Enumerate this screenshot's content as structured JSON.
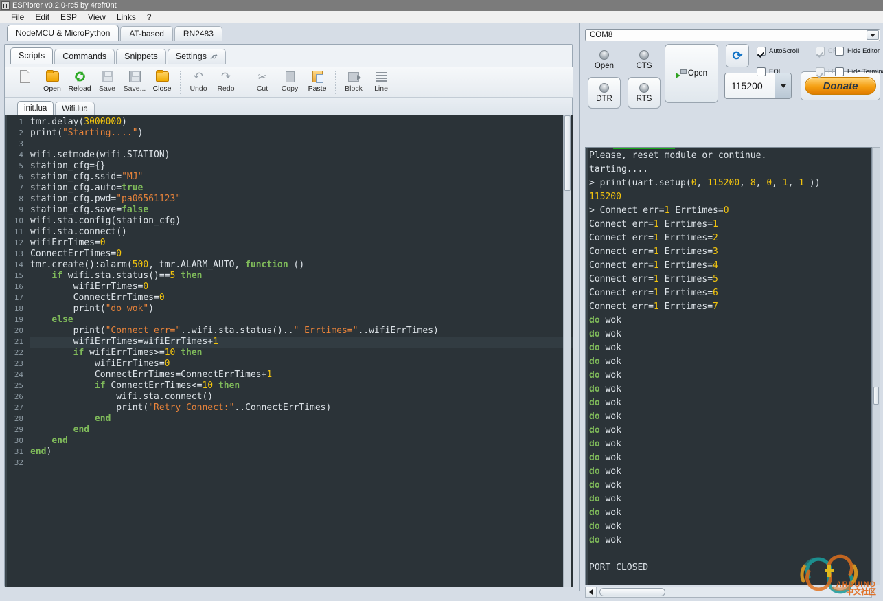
{
  "window": {
    "title": "ESPlorer v0.2.0-rc5 by 4refr0nt",
    "icon": "app-icon"
  },
  "menubar": [
    "File",
    "Edit",
    "ESP",
    "View",
    "Links",
    "?"
  ],
  "top_tabs": [
    {
      "label": "NodeMCU & MicroPython",
      "active": true
    },
    {
      "label": "AT-based",
      "active": false
    },
    {
      "label": "RN2483",
      "active": false
    }
  ],
  "sub_tabs": [
    {
      "label": "Scripts",
      "active": true
    },
    {
      "label": "Commands",
      "active": false
    },
    {
      "label": "Snippets",
      "active": false
    },
    {
      "label": "Settings",
      "active": false,
      "icon": "wrench-icon"
    }
  ],
  "toolbar": [
    {
      "label": "",
      "icon": "new-file-icon",
      "enabled": true
    },
    {
      "label": "Open",
      "icon": "folder-open-icon",
      "enabled": true
    },
    {
      "label": "Reload",
      "icon": "reload-icon",
      "enabled": true
    },
    {
      "label": "Save",
      "icon": "save-icon",
      "enabled": false
    },
    {
      "label": "Save...",
      "icon": "save-as-icon",
      "enabled": false
    },
    {
      "label": "Close",
      "icon": "close-folder-icon",
      "enabled": true
    },
    {
      "label": "Undo",
      "icon": "undo-icon",
      "enabled": false
    },
    {
      "label": "Redo",
      "icon": "redo-icon",
      "enabled": false
    },
    {
      "label": "Cut",
      "icon": "scissors-icon",
      "enabled": false
    },
    {
      "label": "Copy",
      "icon": "copy-icon",
      "enabled": false
    },
    {
      "label": "Paste",
      "icon": "paste-icon",
      "enabled": true
    },
    {
      "label": "Block",
      "icon": "send-block-icon",
      "enabled": false
    },
    {
      "label": "Line",
      "icon": "send-line-icon",
      "enabled": false
    }
  ],
  "file_tabs": [
    {
      "label": "init.lua",
      "active": true
    },
    {
      "label": "Wifi.lua",
      "active": false
    }
  ],
  "editor": {
    "current_line": 21,
    "total_lines": 32,
    "lines": [
      {
        "n": 1,
        "tokens": [
          {
            "t": "nm",
            "v": "tmr.delay("
          },
          {
            "t": "n",
            "v": "3000000"
          },
          {
            "t": "nm",
            "v": ")"
          }
        ]
      },
      {
        "n": 2,
        "tokens": [
          {
            "t": "nm",
            "v": "print("
          },
          {
            "t": "s",
            "v": "\"Starting....\""
          },
          {
            "t": "nm",
            "v": ")"
          }
        ]
      },
      {
        "n": 3,
        "tokens": []
      },
      {
        "n": 4,
        "tokens": [
          {
            "t": "nm",
            "v": "wifi.setmode(wifi.STATION)"
          }
        ]
      },
      {
        "n": 5,
        "tokens": [
          {
            "t": "nm",
            "v": "station_cfg={}"
          }
        ]
      },
      {
        "n": 6,
        "tokens": [
          {
            "t": "nm",
            "v": "station_cfg.ssid="
          },
          {
            "t": "s",
            "v": "\"MJ\""
          }
        ]
      },
      {
        "n": 7,
        "tokens": [
          {
            "t": "nm",
            "v": "station_cfg.auto="
          },
          {
            "t": "k",
            "v": "true"
          }
        ]
      },
      {
        "n": 8,
        "tokens": [
          {
            "t": "nm",
            "v": "station_cfg.pwd="
          },
          {
            "t": "s",
            "v": "\"pa06561123\""
          }
        ]
      },
      {
        "n": 9,
        "tokens": [
          {
            "t": "nm",
            "v": "station_cfg.save="
          },
          {
            "t": "k",
            "v": "false"
          }
        ]
      },
      {
        "n": 10,
        "tokens": [
          {
            "t": "nm",
            "v": "wifi.sta.config(station_cfg)"
          }
        ]
      },
      {
        "n": 11,
        "tokens": [
          {
            "t": "nm",
            "v": "wifi.sta.connect()"
          }
        ]
      },
      {
        "n": 12,
        "tokens": [
          {
            "t": "nm",
            "v": "wifiErrTimes="
          },
          {
            "t": "n",
            "v": "0"
          }
        ]
      },
      {
        "n": 13,
        "tokens": [
          {
            "t": "nm",
            "v": "ConnectErrTimes="
          },
          {
            "t": "n",
            "v": "0"
          }
        ]
      },
      {
        "n": 14,
        "tokens": [
          {
            "t": "nm",
            "v": "tmr.create():alarm("
          },
          {
            "t": "n",
            "v": "500"
          },
          {
            "t": "nm",
            "v": ", tmr.ALARM_AUTO, "
          },
          {
            "t": "k",
            "v": "function"
          },
          {
            "t": "nm",
            "v": " ()"
          }
        ]
      },
      {
        "n": 15,
        "tokens": [
          {
            "t": "nm",
            "v": "    "
          },
          {
            "t": "k",
            "v": "if"
          },
          {
            "t": "nm",
            "v": " wifi.sta.status()=="
          },
          {
            "t": "n",
            "v": "5"
          },
          {
            "t": "nm",
            "v": " "
          },
          {
            "t": "k",
            "v": "then"
          }
        ]
      },
      {
        "n": 16,
        "tokens": [
          {
            "t": "nm",
            "v": "        wifiErrTimes="
          },
          {
            "t": "n",
            "v": "0"
          }
        ]
      },
      {
        "n": 17,
        "tokens": [
          {
            "t": "nm",
            "v": "        ConnectErrTimes="
          },
          {
            "t": "n",
            "v": "0"
          }
        ]
      },
      {
        "n": 18,
        "tokens": [
          {
            "t": "nm",
            "v": "        print("
          },
          {
            "t": "s",
            "v": "\"do wok\""
          },
          {
            "t": "nm",
            "v": ")"
          }
        ]
      },
      {
        "n": 19,
        "tokens": [
          {
            "t": "nm",
            "v": "    "
          },
          {
            "t": "k",
            "v": "else"
          }
        ]
      },
      {
        "n": 20,
        "tokens": [
          {
            "t": "nm",
            "v": "        print("
          },
          {
            "t": "s",
            "v": "\"Connect err=\""
          },
          {
            "t": "nm",
            "v": "..wifi.sta.status().."
          },
          {
            "t": "s",
            "v": "\" Errtimes=\""
          },
          {
            "t": "nm",
            "v": "..wifiErrTimes)"
          }
        ]
      },
      {
        "n": 21,
        "tokens": [
          {
            "t": "nm",
            "v": "        wifiErrTimes=wifiErrTimes+"
          },
          {
            "t": "n",
            "v": "1"
          }
        ]
      },
      {
        "n": 22,
        "tokens": [
          {
            "t": "nm",
            "v": "        "
          },
          {
            "t": "k",
            "v": "if"
          },
          {
            "t": "nm",
            "v": " wifiErrTimes>="
          },
          {
            "t": "n",
            "v": "10"
          },
          {
            "t": "nm",
            "v": " "
          },
          {
            "t": "k",
            "v": "then"
          }
        ]
      },
      {
        "n": 23,
        "tokens": [
          {
            "t": "nm",
            "v": "            wifiErrTimes="
          },
          {
            "t": "n",
            "v": "0"
          }
        ]
      },
      {
        "n": 24,
        "tokens": [
          {
            "t": "nm",
            "v": "            ConnectErrTimes=ConnectErrTimes+"
          },
          {
            "t": "n",
            "v": "1"
          }
        ]
      },
      {
        "n": 25,
        "tokens": [
          {
            "t": "nm",
            "v": "            "
          },
          {
            "t": "k",
            "v": "if"
          },
          {
            "t": "nm",
            "v": " ConnectErrTimes<="
          },
          {
            "t": "n",
            "v": "10"
          },
          {
            "t": "nm",
            "v": " "
          },
          {
            "t": "k",
            "v": "then"
          }
        ]
      },
      {
        "n": 26,
        "tokens": [
          {
            "t": "nm",
            "v": "                wifi.sta.connect()"
          }
        ]
      },
      {
        "n": 27,
        "tokens": [
          {
            "t": "nm",
            "v": "                print("
          },
          {
            "t": "s",
            "v": "\"Retry Connect:\""
          },
          {
            "t": "nm",
            "v": "..ConnectErrTimes)"
          }
        ]
      },
      {
        "n": 28,
        "tokens": [
          {
            "t": "nm",
            "v": "            "
          },
          {
            "t": "k",
            "v": "end"
          }
        ]
      },
      {
        "n": 29,
        "tokens": [
          {
            "t": "nm",
            "v": "        "
          },
          {
            "t": "k",
            "v": "end"
          }
        ]
      },
      {
        "n": 30,
        "tokens": [
          {
            "t": "nm",
            "v": "    "
          },
          {
            "t": "k",
            "v": "end"
          }
        ]
      },
      {
        "n": 31,
        "tokens": [
          {
            "t": "k",
            "v": "end"
          },
          {
            "t": "nm",
            "v": ")"
          }
        ]
      },
      {
        "n": 32,
        "tokens": []
      }
    ]
  },
  "com": {
    "port": "COM8",
    "baud": "115200",
    "leds": [
      {
        "label": "Open",
        "state": "off"
      },
      {
        "label": "CTS",
        "state": "off"
      },
      {
        "label": "DTR",
        "state": "off"
      },
      {
        "label": "RTS",
        "state": "off"
      }
    ],
    "open_button": "Open",
    "refresh_icon": "refresh-icon",
    "donate_label": "Donate",
    "checkboxes": [
      {
        "label": "AutoScroll",
        "checked": true,
        "enabled": true
      },
      {
        "label": "EOL",
        "checked": false,
        "enabled": true
      },
      {
        "label": "CR",
        "checked": true,
        "enabled": false
      },
      {
        "label": "LF",
        "checked": true,
        "enabled": false
      },
      {
        "label": "Hide Editor",
        "checked": false,
        "enabled": true
      },
      {
        "label": "Hide Terminal",
        "checked": false,
        "enabled": true
      }
    ]
  },
  "terminal": {
    "lines": [
      [
        {
          "t": "nm",
          "v": "Please, reset module or continue."
        }
      ],
      [
        {
          "t": "nm",
          "v": "tarting...."
        }
      ],
      [
        {
          "t": "nm",
          "v": "> print(uart.setup("
        },
        {
          "t": "n",
          "v": "0"
        },
        {
          "t": "nm",
          "v": ", "
        },
        {
          "t": "n",
          "v": "115200"
        },
        {
          "t": "nm",
          "v": ", "
        },
        {
          "t": "n",
          "v": "8"
        },
        {
          "t": "nm",
          "v": ", "
        },
        {
          "t": "n",
          "v": "0"
        },
        {
          "t": "nm",
          "v": ", "
        },
        {
          "t": "n",
          "v": "1"
        },
        {
          "t": "nm",
          "v": ", "
        },
        {
          "t": "n",
          "v": "1"
        },
        {
          "t": "nm",
          "v": " ))"
        }
      ],
      [
        {
          "t": "n",
          "v": "115200"
        }
      ],
      [
        {
          "t": "nm",
          "v": "> Connect err="
        },
        {
          "t": "n",
          "v": "1"
        },
        {
          "t": "nm",
          "v": " Errtimes="
        },
        {
          "t": "n",
          "v": "0"
        }
      ],
      [
        {
          "t": "nm",
          "v": "Connect err="
        },
        {
          "t": "n",
          "v": "1"
        },
        {
          "t": "nm",
          "v": " Errtimes="
        },
        {
          "t": "n",
          "v": "1"
        }
      ],
      [
        {
          "t": "nm",
          "v": "Connect err="
        },
        {
          "t": "n",
          "v": "1"
        },
        {
          "t": "nm",
          "v": " Errtimes="
        },
        {
          "t": "n",
          "v": "2"
        }
      ],
      [
        {
          "t": "nm",
          "v": "Connect err="
        },
        {
          "t": "n",
          "v": "1"
        },
        {
          "t": "nm",
          "v": " Errtimes="
        },
        {
          "t": "n",
          "v": "3"
        }
      ],
      [
        {
          "t": "nm",
          "v": "Connect err="
        },
        {
          "t": "n",
          "v": "1"
        },
        {
          "t": "nm",
          "v": " Errtimes="
        },
        {
          "t": "n",
          "v": "4"
        }
      ],
      [
        {
          "t": "nm",
          "v": "Connect err="
        },
        {
          "t": "n",
          "v": "1"
        },
        {
          "t": "nm",
          "v": " Errtimes="
        },
        {
          "t": "n",
          "v": "5"
        }
      ],
      [
        {
          "t": "nm",
          "v": "Connect err="
        },
        {
          "t": "n",
          "v": "1"
        },
        {
          "t": "nm",
          "v": " Errtimes="
        },
        {
          "t": "n",
          "v": "6"
        }
      ],
      [
        {
          "t": "nm",
          "v": "Connect err="
        },
        {
          "t": "n",
          "v": "1"
        },
        {
          "t": "nm",
          "v": " Errtimes="
        },
        {
          "t": "n",
          "v": "7"
        }
      ],
      [
        {
          "t": "k",
          "v": "do"
        },
        {
          "t": "nm",
          "v": " wok"
        }
      ],
      [
        {
          "t": "k",
          "v": "do"
        },
        {
          "t": "nm",
          "v": " wok"
        }
      ],
      [
        {
          "t": "k",
          "v": "do"
        },
        {
          "t": "nm",
          "v": " wok"
        }
      ],
      [
        {
          "t": "k",
          "v": "do"
        },
        {
          "t": "nm",
          "v": " wok"
        }
      ],
      [
        {
          "t": "k",
          "v": "do"
        },
        {
          "t": "nm",
          "v": " wok"
        }
      ],
      [
        {
          "t": "k",
          "v": "do"
        },
        {
          "t": "nm",
          "v": " wok"
        }
      ],
      [
        {
          "t": "k",
          "v": "do"
        },
        {
          "t": "nm",
          "v": " wok"
        }
      ],
      [
        {
          "t": "k",
          "v": "do"
        },
        {
          "t": "nm",
          "v": " wok"
        }
      ],
      [
        {
          "t": "k",
          "v": "do"
        },
        {
          "t": "nm",
          "v": " wok"
        }
      ],
      [
        {
          "t": "k",
          "v": "do"
        },
        {
          "t": "nm",
          "v": " wok"
        }
      ],
      [
        {
          "t": "k",
          "v": "do"
        },
        {
          "t": "nm",
          "v": " wok"
        }
      ],
      [
        {
          "t": "k",
          "v": "do"
        },
        {
          "t": "nm",
          "v": " wok"
        }
      ],
      [
        {
          "t": "k",
          "v": "do"
        },
        {
          "t": "nm",
          "v": " wok"
        }
      ],
      [
        {
          "t": "k",
          "v": "do"
        },
        {
          "t": "nm",
          "v": " wok"
        }
      ],
      [
        {
          "t": "k",
          "v": "do"
        },
        {
          "t": "nm",
          "v": " wok"
        }
      ],
      [
        {
          "t": "k",
          "v": "do"
        },
        {
          "t": "nm",
          "v": " wok"
        }
      ],
      [
        {
          "t": "k",
          "v": "do"
        },
        {
          "t": "nm",
          "v": " wok"
        }
      ],
      [],
      [
        {
          "t": "nm",
          "v": "PORT CLOSED"
        }
      ]
    ]
  },
  "watermark": {
    "line1": "ARDUINO",
    "line2": "中文社区"
  },
  "colors": {
    "editor_bg": "#2b3338",
    "keyword": "#7fba5a",
    "string": "#e8833a",
    "number": "#f2c40e",
    "text": "#dde3e8",
    "donate_accent": "#f59e10",
    "led_off": "#9aa3ab",
    "terminal_marker": "#1aa81a"
  }
}
